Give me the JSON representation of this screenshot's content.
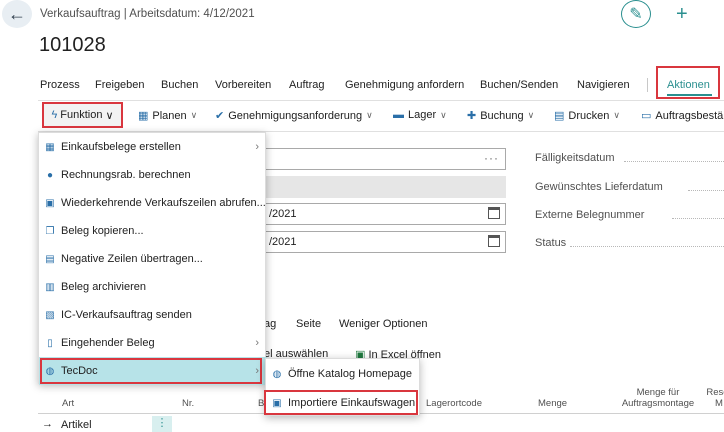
{
  "header": {
    "subtitle": "Verkaufsauftrag | Arbeitsdatum: 4/12/2021",
    "record_no": "101028",
    "back_icon": "←",
    "edit_icon": "✎",
    "new_icon": "+"
  },
  "actionbar": {
    "items": [
      "Prozess",
      "Freigeben",
      "Buchen",
      "Vorbereiten",
      "Auftrag",
      "Genehmigung anfordern",
      "Buchen/Senden",
      "Navigieren"
    ],
    "aktionen": "Aktionen"
  },
  "bar2": {
    "funktion": "Funktion",
    "planen": "Planen",
    "genehmigung": "Genehmigungsanforderung",
    "lager": "Lager",
    "buchung": "Buchung",
    "drucken": "Drucken",
    "auftragsbest": "Auftragsbestä"
  },
  "form": {
    "date1": "/2021",
    "date2": "/2021",
    "labels": [
      "Fälligkeitsdatum",
      "Gewünschtes Lieferdatum",
      "Externe Belegnummer",
      "Status"
    ]
  },
  "lines": {
    "tabs": [
      "ag",
      "Seite",
      "Weniger Optionen"
    ],
    "actions": [
      "el auswählen",
      "In Excel öffnen"
    ],
    "columns": {
      "art": "Art",
      "nr": "Nr.",
      "b": "B",
      "lagerortcode": "Lagerortcode",
      "menge": "Menge",
      "menge_fuer_line1": "Menge für",
      "menge_fuer_line2": "Auftragsmontage",
      "reser_line1": "Reser",
      "reser_line2": "M"
    },
    "row1_arrow": "→",
    "row1_art": "Artikel"
  },
  "menu": {
    "items": [
      {
        "label": "Einkaufsbelege erstellen",
        "icon": "▦",
        "sub": true
      },
      {
        "label": "Rechnungsrab. berechnen",
        "icon": "●",
        "sub": false
      },
      {
        "label": "Wiederkehrende Verkaufszeilen abrufen...",
        "icon": "▣",
        "sub": false
      },
      {
        "label": "Beleg kopieren...",
        "icon": "❐",
        "sub": false
      },
      {
        "label": "Negative Zeilen übertragen...",
        "icon": "▤",
        "sub": false
      },
      {
        "label": "Beleg archivieren",
        "icon": "▥",
        "sub": false
      },
      {
        "label": "IC-Verkaufsauftrag senden",
        "icon": "▧",
        "sub": false
      },
      {
        "label": "Eingehender Beleg",
        "icon": "▯",
        "sub": true
      },
      {
        "label": "TecDoc",
        "icon": "◍",
        "sub": true
      }
    ]
  },
  "submenu": {
    "items": [
      {
        "label": "Öffne Katalog Homepage",
        "icon": "◍"
      },
      {
        "label": "Importiere Einkaufswagen",
        "icon": "▣"
      }
    ]
  },
  "colors": {
    "accent": "#2a8f8f",
    "highlight_red": "#d9363e",
    "tecdoc_bg": "#b7e3e8"
  }
}
